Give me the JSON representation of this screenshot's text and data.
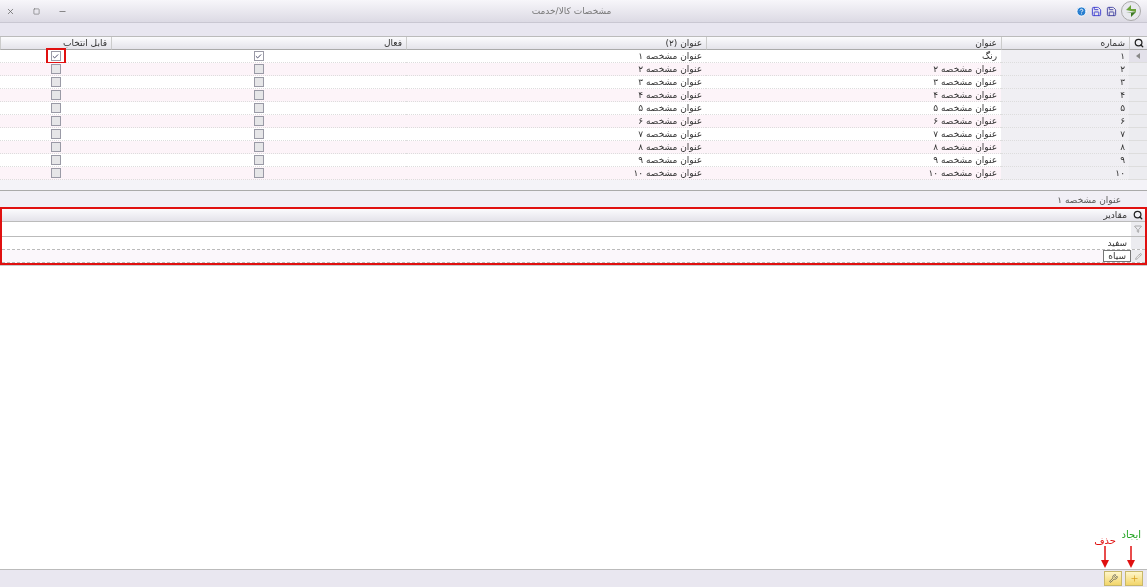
{
  "window": {
    "title": "مشخصات کالا/خدمت"
  },
  "grid": {
    "columns": [
      "شماره",
      "عنوان",
      "عنوان (۲)",
      "فعال",
      "قابل انتخاب"
    ],
    "rows": [
      {
        "number": "۱",
        "title": "رنگ",
        "title2": "عنوان مشخصه ۱",
        "active": true,
        "selectable": true,
        "selected": true,
        "highlighted": true
      },
      {
        "number": "۲",
        "title": "عنوان مشخصه ۲",
        "title2": "عنوان مشخصه ۲",
        "active": false,
        "selectable": false,
        "selected": false,
        "highlighted": false
      },
      {
        "number": "۳",
        "title": "عنوان مشخصه ۳",
        "title2": "عنوان مشخصه ۳",
        "active": false,
        "selectable": false,
        "selected": false,
        "highlighted": false
      },
      {
        "number": "۴",
        "title": "عنوان مشخصه ۴",
        "title2": "عنوان مشخصه ۴",
        "active": false,
        "selectable": false,
        "selected": false,
        "highlighted": false
      },
      {
        "number": "۵",
        "title": "عنوان مشخصه ۵",
        "title2": "عنوان مشخصه ۵",
        "active": false,
        "selectable": false,
        "selected": false,
        "highlighted": false
      },
      {
        "number": "۶",
        "title": "عنوان مشخصه ۶",
        "title2": "عنوان مشخصه ۶",
        "active": false,
        "selectable": false,
        "selected": false,
        "highlighted": false
      },
      {
        "number": "۷",
        "title": "عنوان مشخصه ۷",
        "title2": "عنوان مشخصه ۷",
        "active": false,
        "selectable": false,
        "selected": false,
        "highlighted": false
      },
      {
        "number": "۸",
        "title": "عنوان مشخصه ۸",
        "title2": "عنوان مشخصه ۸",
        "active": false,
        "selectable": false,
        "selected": false,
        "highlighted": false
      },
      {
        "number": "۹",
        "title": "عنوان مشخصه ۹",
        "title2": "عنوان مشخصه ۹",
        "active": false,
        "selectable": false,
        "selected": false,
        "highlighted": false
      },
      {
        "number": "۱۰",
        "title": "عنوان مشخصه ۱۰",
        "title2": "عنوان مشخصه ۱۰",
        "active": false,
        "selectable": false,
        "selected": false,
        "highlighted": false
      }
    ]
  },
  "values_caption": "عنوان مشخصه ۱",
  "values": {
    "highlighted": true,
    "column": "مقادیر",
    "rows": [
      {
        "value": "سفید",
        "editing": false
      },
      {
        "value": "سیاه",
        "editing": true
      }
    ]
  },
  "buttons": [
    {
      "kind": "add",
      "callout": "ایجاد",
      "color": "#1fa31f"
    },
    {
      "kind": "delete",
      "callout": "حذف",
      "color": "#e01010"
    }
  ]
}
